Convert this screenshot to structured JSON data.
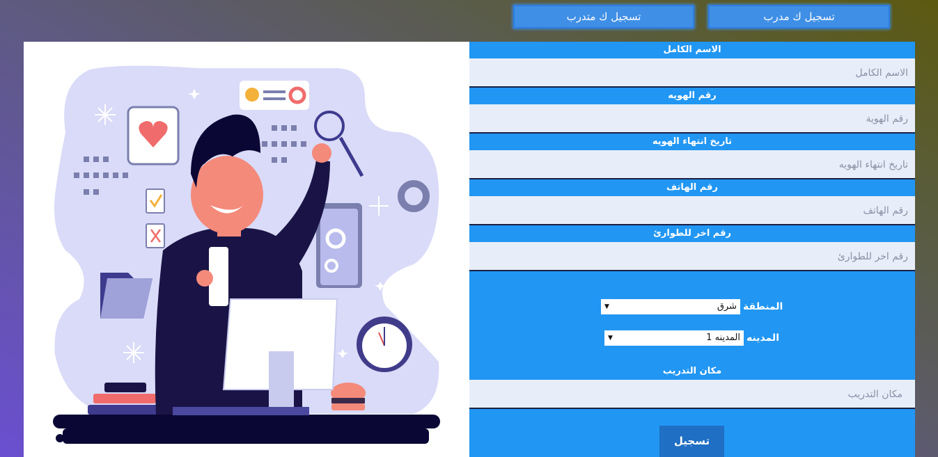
{
  "header": {
    "register_trainer": "تسجيل ك مدرب",
    "register_trainee": "تسجيل ك متدرب"
  },
  "form": {
    "fields": [
      {
        "label": "الاسم الكامل",
        "placeholder": "الاسم الكامل"
      },
      {
        "label": "رقم الهويه",
        "placeholder": "رقم الهوية"
      },
      {
        "label": "تاريخ انتهاء الهويه",
        "placeholder": "تاريخ انتهاء الهويه"
      },
      {
        "label": "رقم الهاتف",
        "placeholder": "رقم الهاتف"
      },
      {
        "label": "رقم اخر للطوارئ",
        "placeholder": "رقم اخر للطوارئ"
      }
    ],
    "region": {
      "label": "المنطقة",
      "value": "شرق"
    },
    "city": {
      "label": "المدينه",
      "value": "المدينه 1"
    },
    "training_place": {
      "label": "مكان التدريب",
      "placeholder": "مكان التدريب"
    },
    "submit_label": "تسجيل"
  },
  "colors": {
    "form_bg": "#2196f3",
    "button_bg": "#3f8fe6",
    "submit_bg": "#1f6fc4",
    "field_bg": "#e8eef9"
  },
  "illustration": {
    "description_icon": "developer-illustration"
  }
}
